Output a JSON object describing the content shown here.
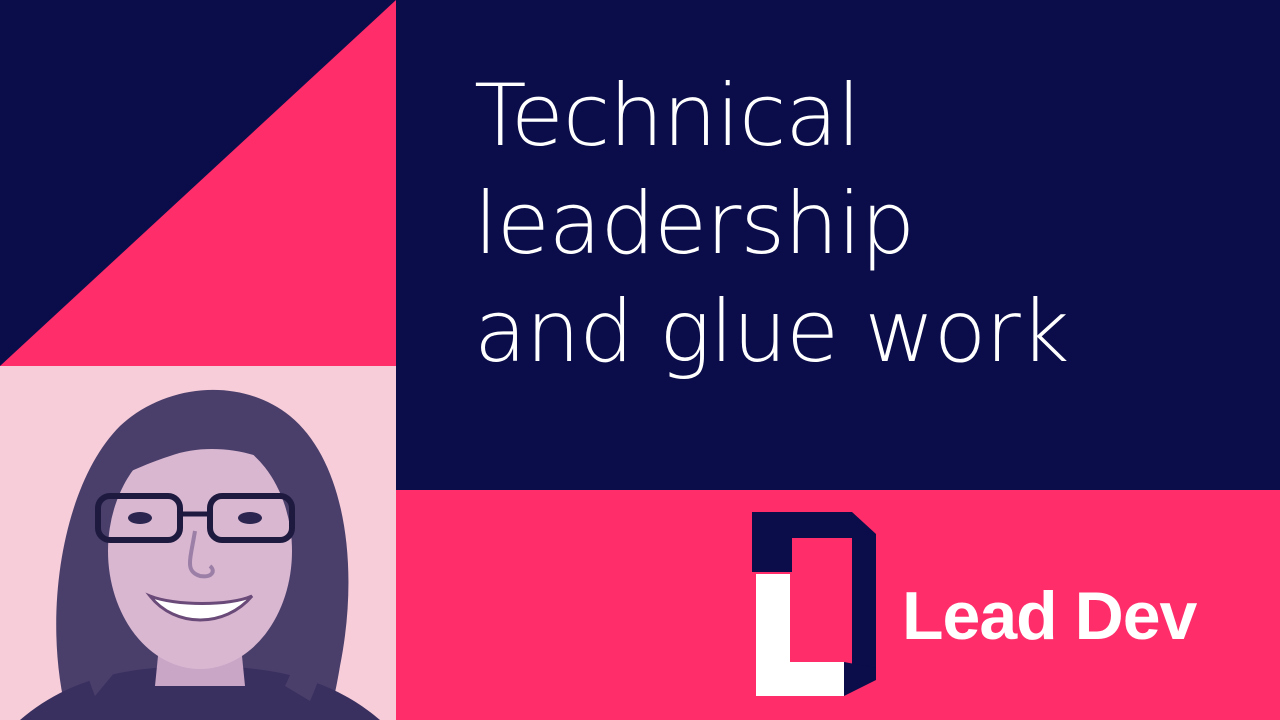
{
  "talk": {
    "title_lines": [
      "Technical",
      "leadership",
      "and glue work"
    ]
  },
  "brand": {
    "name": "Lead Dev",
    "logo_icon": "lead-dev-logo-icon"
  },
  "speaker": {
    "photo": "speaker-portrait"
  },
  "colors": {
    "navy": "#0b0d4a",
    "pink": "#ff2d6a",
    "light_pink": "#f7cdd9",
    "white": "#ffffff"
  }
}
